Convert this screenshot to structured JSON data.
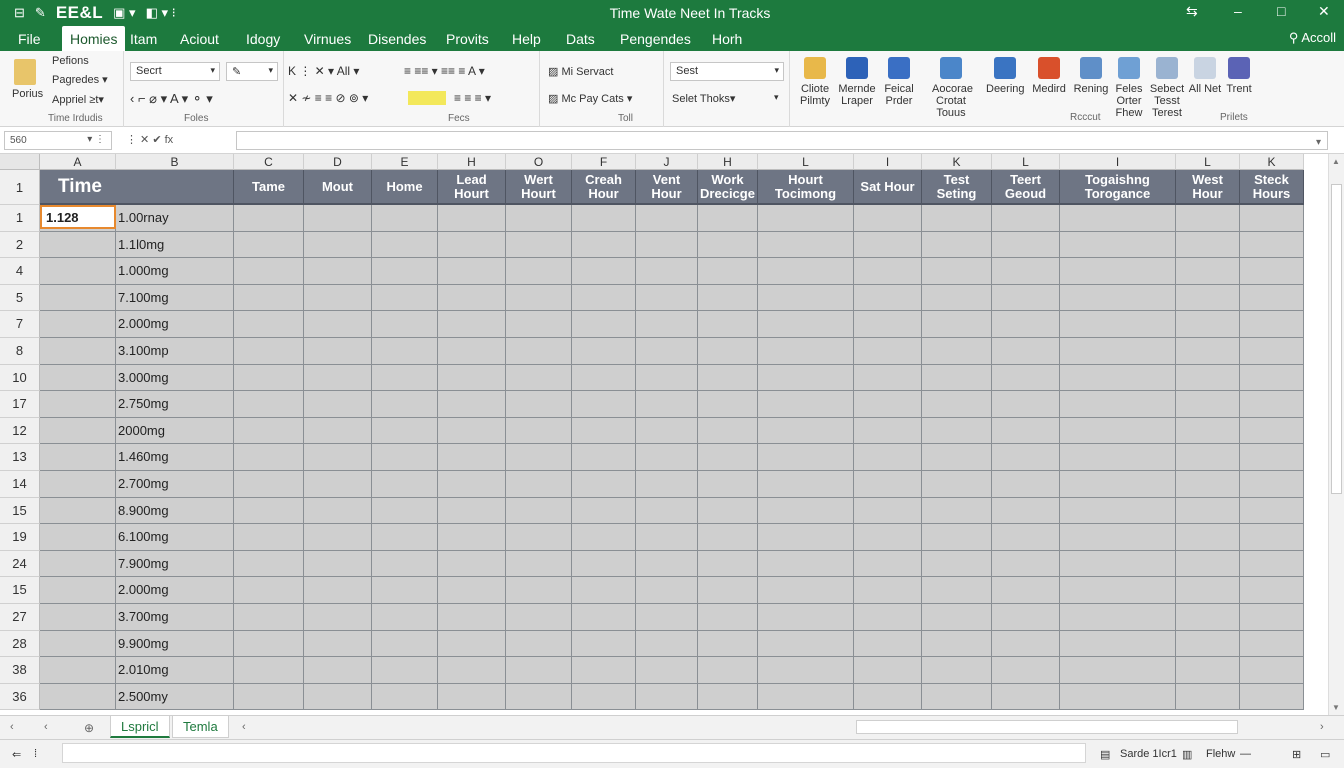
{
  "titlebar": {
    "app_name": "EE&L",
    "title": "Time Wate Neet In Tracks",
    "minimize": "⇆",
    "restore": "–",
    "maximize": "□",
    "close": "✕"
  },
  "menu": {
    "tabs": [
      "File",
      "Homies",
      "Itam",
      "Aciout",
      "Idogy",
      "Virnues",
      "Disendes",
      "Provits",
      "Help",
      "Dats",
      "Pengendes",
      "Horh"
    ],
    "active_index": 1,
    "account": "Accoll"
  },
  "ribbon": {
    "clipboard": {
      "paste": "Porius",
      "items": [
        "Pefions",
        "Pagredes ▾",
        "Appriel ≥t▾"
      ],
      "label": "Time Irdudis"
    },
    "font": {
      "font_name": "Secrt",
      "font_size": "",
      "label": "Foles",
      "top_icons": "K  ⋮   ✕ ▾   All ▾"
    },
    "alignment": {
      "label": "Fecs"
    },
    "styles": {
      "item1": "Mi Servact",
      "item2": "Mc Pay Cats ▾",
      "label": "Toll"
    },
    "cells": {
      "select1": "Sest",
      "select2": "Selet Thoks▾"
    },
    "big_buttons": [
      {
        "caption": "Cliote Pilmty",
        "color": "#e8b84a"
      },
      {
        "caption": "Mernde Lraper",
        "color": "#2d62b8"
      },
      {
        "caption": "Feical Prder",
        "color": "#3a6fc4"
      },
      {
        "caption": "Aocorae Crotat Touus",
        "color": "#4b86c9"
      },
      {
        "caption": "Deering",
        "color": "#3a74c2"
      },
      {
        "caption": "Medird",
        "color": "#d9502b"
      },
      {
        "caption": "Rening",
        "color": "#5f8fc8"
      },
      {
        "caption": "Feles Orter Fhew",
        "color": "#6fa0d4"
      },
      {
        "caption": "Sebect Tesst Terest",
        "color": "#9ab3d1"
      },
      {
        "caption": "All Net",
        "color": "#c9d4e2"
      },
      {
        "caption": "Trent",
        "color": "#5b63b5"
      }
    ],
    "group_labels": {
      "recout": "Rcccut",
      "prilets": "Prilets"
    }
  },
  "formula_bar": {
    "name_box": "560",
    "fx_icons": "⋮    ✕    ✔    fx"
  },
  "grid": {
    "col_letters": [
      "A",
      "B",
      "C",
      "D",
      "E",
      "H",
      "O",
      "F",
      "J",
      "H",
      "L",
      "I",
      "K",
      "L",
      "I",
      "L",
      "K"
    ],
    "header_row_number": "1",
    "headers": [
      "Time",
      "",
      "Tame",
      "Mout",
      "Home",
      "Lead Hourt",
      "Wert Hourt",
      "Creah Hour",
      "Vent Hour",
      "Work Drecicge",
      "Hourt Tocimong",
      "Sat Hour",
      "Test Seting",
      "Teert Geoud",
      "Togaishng Torogance",
      "West Hour",
      "Steck Hours"
    ],
    "rows": [
      {
        "num": "1",
        "a": "1.128",
        "b": "1.00rnay"
      },
      {
        "num": "2",
        "a": "",
        "b": "1.1l0mg"
      },
      {
        "num": "4",
        "a": "",
        "b": "1.000mg"
      },
      {
        "num": "5",
        "a": "",
        "b": "7.100mg"
      },
      {
        "num": "7",
        "a": "",
        "b": "2.000mg"
      },
      {
        "num": "8",
        "a": "",
        "b": "3.100mp"
      },
      {
        "num": "10",
        "a": "",
        "b": "3.000mg"
      },
      {
        "num": "17",
        "a": "",
        "b": "2.750mg"
      },
      {
        "num": "12",
        "a": "",
        "b": "2000mg"
      },
      {
        "num": "13",
        "a": "",
        "b": "1.460mg"
      },
      {
        "num": "14",
        "a": "",
        "b": "2.700mg"
      },
      {
        "num": "15",
        "a": "",
        "b": "8.900mg"
      },
      {
        "num": "19",
        "a": "",
        "b": "6.100mg"
      },
      {
        "num": "24",
        "a": "",
        "b": "7.900mg"
      },
      {
        "num": "15",
        "a": "",
        "b": "2.000mg"
      },
      {
        "num": "27",
        "a": "",
        "b": "3.700mg"
      },
      {
        "num": "28",
        "a": "",
        "b": "9.900mg"
      },
      {
        "num": "38",
        "a": "",
        "b": "2.010mg"
      },
      {
        "num": "36",
        "a": "",
        "b": "2.500my"
      }
    ]
  },
  "sheets": {
    "tabs": [
      "Lspricl",
      "Temla"
    ],
    "nav_prev": "‹",
    "nav_next": "‹",
    "add": "⊕"
  },
  "statusbar": {
    "left_icon": "⇐",
    "page_info": "Sarde 1Icr1",
    "view": "Flehw",
    "zoom_minus": "—",
    "zoom_plus": "⊞"
  }
}
